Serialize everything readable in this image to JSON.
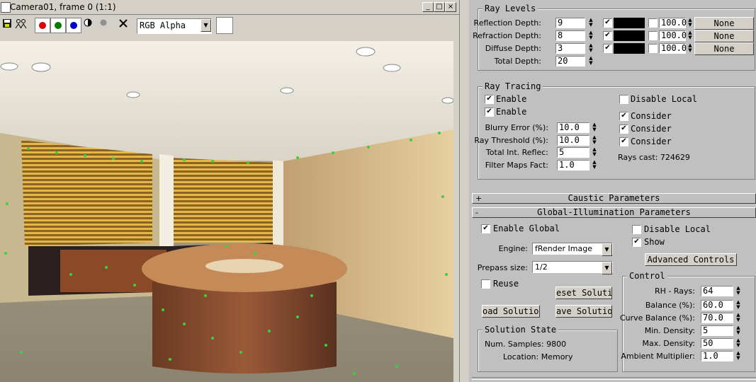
{
  "render_window": {
    "title": "Camera01, frame 0 (1:1)",
    "min": "_",
    "max": "□",
    "close": "×",
    "toolbar": {
      "channel_select": "RGB Alpha"
    },
    "colors": {
      "red": "#e00000",
      "green": "#008000",
      "blue": "#0000d0",
      "grey": "#909090"
    }
  },
  "ray_levels": {
    "title": "Ray Levels",
    "rows": [
      {
        "label": "Reflection Depth:",
        "value": "9",
        "pct": "100.0",
        "btn": "None",
        "checked": true
      },
      {
        "label": "Refraction Depth:",
        "value": "8",
        "pct": "100.0",
        "btn": "None",
        "checked": true
      },
      {
        "label": "Diffuse Depth:",
        "value": "3",
        "pct": "100.0",
        "btn": "None",
        "checked": true
      }
    ],
    "total_label": "Total Depth:",
    "total_value": "20"
  },
  "ray_tracing": {
    "title": "Ray Tracing",
    "enable1": "Enable",
    "enable2": "Enable",
    "disable_local": "Disable Local",
    "consider1": "Consider",
    "consider2": "Consider",
    "consider3": "Consider",
    "blurry_label": "Blurry Error (%):",
    "blurry_value": "10.0",
    "threshold_label": "Ray Threshold (%):",
    "threshold_value": "10.0",
    "tir_label": "Total Int. Reflec:",
    "tir_value": "5",
    "filter_label": "Filter Maps Fact:",
    "filter_value": "1.0",
    "rays_cast": "Rays cast:  724629"
  },
  "caustic": {
    "sign": "+",
    "title": "Caustic Parameters"
  },
  "gi": {
    "sign": "-",
    "title": "Global-Illumination Parameters",
    "enable_global": "Enable Global",
    "disable_local": "Disable Local",
    "show": "Show",
    "engine_label": "Engine:",
    "engine_value": "fRender Image",
    "prepass_label": "Prepass size:",
    "prepass_value": "1/2",
    "reuse": "Reuse",
    "reset_btn": "eset Solutio",
    "load_btn": "oad Solution",
    "save_btn": "ave Solution",
    "advanced_btn": "Advanced Controls",
    "solution_title": "Solution State",
    "num_samples": "Num. Samples:  9800",
    "location": "Location:  Memory",
    "control_title": "Control",
    "controls": [
      {
        "label": "RH - Rays:",
        "value": "64"
      },
      {
        "label": "Balance (%):",
        "value": "60.0"
      },
      {
        "label": "Curve Balance (%):",
        "value": "70.0"
      },
      {
        "label": "Min. Density:",
        "value": "5"
      },
      {
        "label": "Max. Density:",
        "value": "50"
      },
      {
        "label": "Ambient Multiplier:",
        "value": "1.0"
      }
    ]
  }
}
